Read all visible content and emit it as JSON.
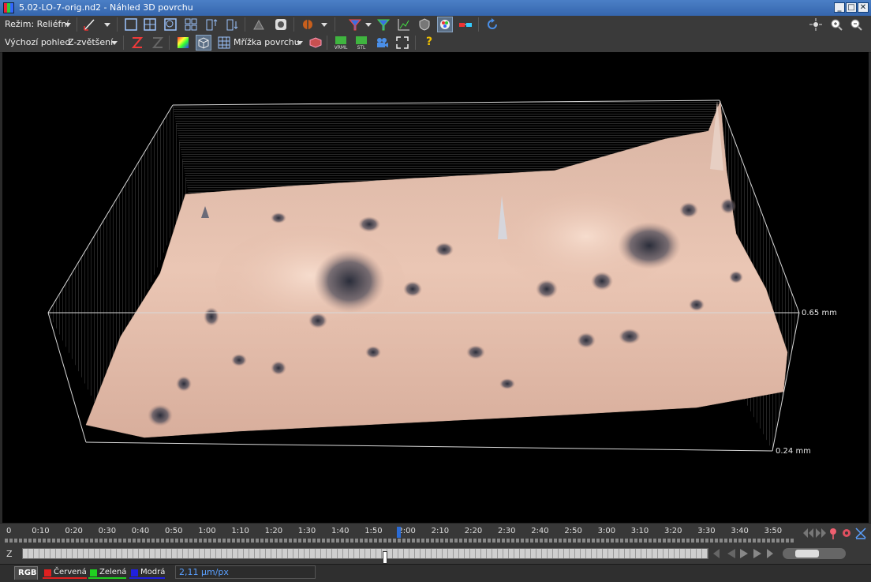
{
  "window": {
    "title": "5.02-LO-7-orig.nd2 - Náhled 3D povrchu",
    "controls": [
      "_",
      "□",
      "✕"
    ]
  },
  "toolbar1": {
    "mode_label": "Režim: Reliéfní"
  },
  "toolbar2": {
    "default_view": "Výchozí pohled",
    "z_zoom": "Z-zvětšení",
    "surface_grid": "Mřížka povrchu",
    "export_vrml": "VRML",
    "export_stl": "STL",
    "help": "?"
  },
  "viewport": {
    "label_top": "0.65 mm",
    "label_bottom": "0.24 mm",
    "surface_color": "#e8c2b0"
  },
  "timeline": {
    "ticks": [
      "0",
      "0:10",
      "0:20",
      "0:30",
      "0:40",
      "0:50",
      "1:00",
      "1:10",
      "1:20",
      "1:30",
      "1:40",
      "1:50",
      "2:00",
      "2:10",
      "2:20",
      "2:30",
      "2:40",
      "2:50",
      "3:00",
      "3:10",
      "3:20",
      "3:30",
      "3:40",
      "3:50"
    ],
    "current_position": "1:57"
  },
  "zstack": {
    "label": "Z",
    "position_fraction": 0.49
  },
  "channels": {
    "tabs": [
      {
        "label": "RGB",
        "color": ""
      },
      {
        "label": "Červená",
        "color": "#e02020"
      },
      {
        "label": "Zelená",
        "color": "#20d020"
      },
      {
        "label": "Modrá",
        "color": "#2020e0"
      }
    ],
    "calibration": "2,11 µm/px"
  }
}
